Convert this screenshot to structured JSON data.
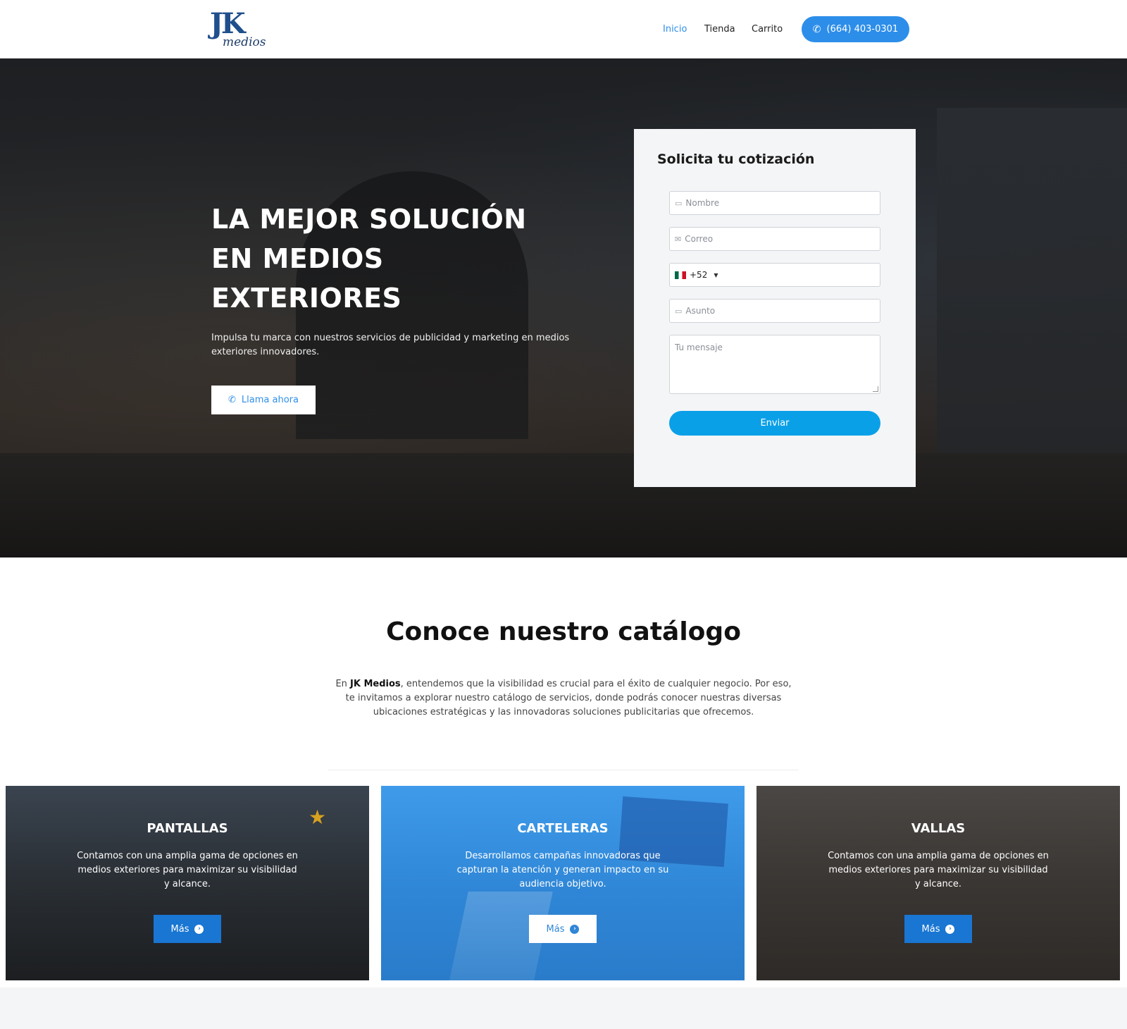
{
  "header": {
    "logo": {
      "mark": "JK",
      "word": "medios"
    },
    "nav": [
      {
        "label": "Inicio"
      },
      {
        "label": "Tienda"
      },
      {
        "label": "Carrito"
      }
    ],
    "phone_button": {
      "icon": "phone-icon",
      "label": "(664) 403-0301"
    }
  },
  "hero": {
    "title_lines": [
      "LA MEJOR SOLUCIÓN",
      "EN MEDIOS",
      "EXTERIORES"
    ],
    "subtitle": "Impulsa tu marca con nuestros servicios de publicidad y marketing en medios exteriores innovadores.",
    "call_button": {
      "icon": "phone-icon",
      "label": "Llama ahora"
    }
  },
  "form": {
    "title": "Solicita tu cotización",
    "name_placeholder": "Nombre",
    "email_placeholder": "Correo",
    "phone_prefix": "+52",
    "phone_flag": "mexico-flag-icon",
    "subject_placeholder": "Asunto",
    "message_placeholder": "Tu mensaje",
    "submit_label": "Enviar"
  },
  "catalog": {
    "title": "Conoce nuestro catálogo",
    "intro_prefix": "En ",
    "intro_brand": "JK Medios",
    "intro_rest": ", entendemos que la visibilidad es crucial para el éxito de cualquier negocio. Por eso, te invitamos a explorar nuestro catálogo de servicios, donde podrás conocer nuestras diversas ubicaciones estratégicas y las innovadoras soluciones publicitarias que ofrecemos.",
    "cards": [
      {
        "title": "PANTALLAS",
        "text": "Contamos con una amplia gama de opciones en medios exteriores para maximizar su visibilidad y alcance.",
        "button": "Más"
      },
      {
        "title": "CARTELERAS",
        "text": "Desarrollamos campañas innovadoras que capturan la atención y generan impacto en su audiencia objetivo.",
        "button": "Más"
      },
      {
        "title": "VALLAS",
        "text": "Contamos con una amplia gama de opciones en medios exteriores para maximizar su visibilidad y alcance.",
        "button": "Más"
      }
    ]
  },
  "colors": {
    "accent": "#2d8eea",
    "submit": "#0aa0e8",
    "card_button": "#1976d2"
  }
}
